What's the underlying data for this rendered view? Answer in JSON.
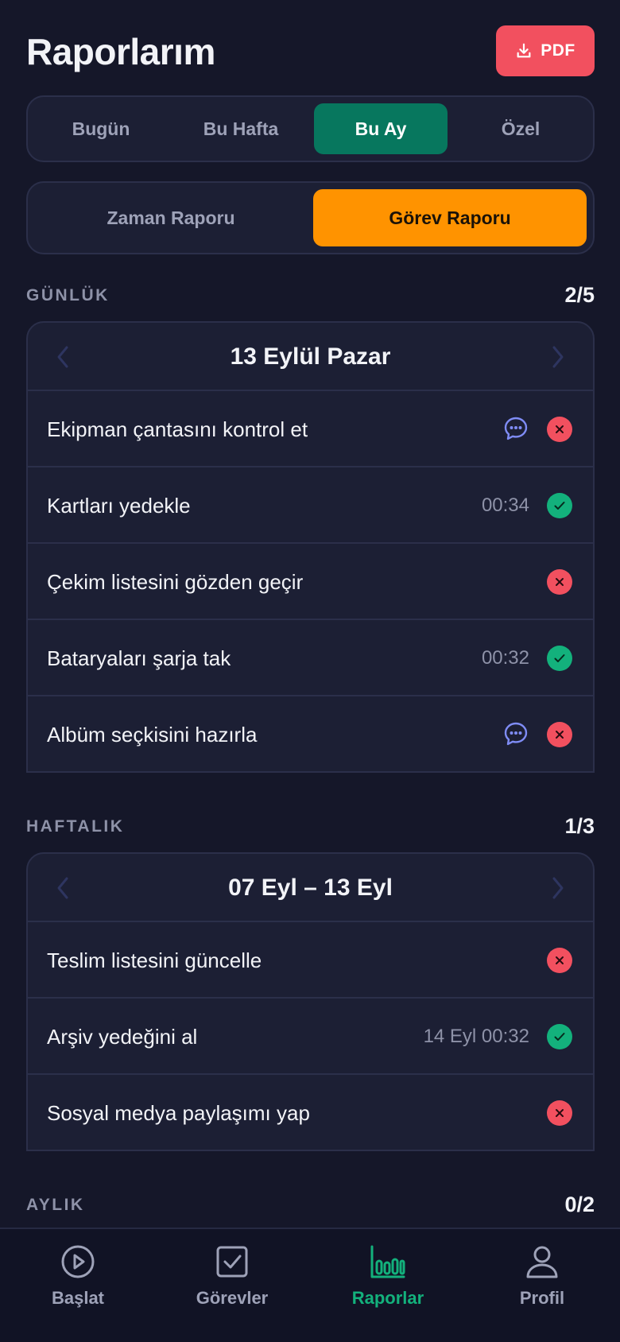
{
  "header": {
    "title": "Raporlarım",
    "pdf_label": "PDF"
  },
  "period_tabs": [
    "Bugün",
    "Bu Hafta",
    "Bu Ay",
    "Özel"
  ],
  "period_selected": "Bu Ay",
  "report_tabs": [
    "Zaman Raporu",
    "Görev Raporu"
  ],
  "report_selected": "Görev Raporu",
  "sections": [
    {
      "label": "GÜNLÜK",
      "count": "2/5",
      "date": "13 Eylül Pazar",
      "tasks": [
        {
          "name": "Ekipman çantasını kontrol et",
          "time": "",
          "has_note": true,
          "status": "fail"
        },
        {
          "name": "Kartları yedekle",
          "time": "00:34",
          "has_note": false,
          "status": "done"
        },
        {
          "name": "Çekim listesini gözden geçir",
          "time": "",
          "has_note": false,
          "status": "fail"
        },
        {
          "name": "Bataryaları şarja tak",
          "time": "00:32",
          "has_note": false,
          "status": "done"
        },
        {
          "name": "Albüm seçkisini hazırla",
          "time": "",
          "has_note": true,
          "status": "fail"
        }
      ]
    },
    {
      "label": "HAFTALIK",
      "count": "1/3",
      "date": "07 Eyl – 13 Eyl",
      "tasks": [
        {
          "name": "Teslim listesini güncelle",
          "time": "",
          "has_note": false,
          "status": "fail"
        },
        {
          "name": "Arşiv yedeğini al",
          "time": "14 Eyl 00:32",
          "has_note": false,
          "status": "done"
        },
        {
          "name": "Sosyal medya paylaşımı yap",
          "time": "",
          "has_note": false,
          "status": "fail"
        }
      ]
    },
    {
      "label": "AYLIK",
      "count": "0/2"
    }
  ],
  "bottom_nav": [
    {
      "label": "Başlat",
      "icon": "play-icon"
    },
    {
      "label": "Görevler",
      "icon": "checkbox-icon"
    },
    {
      "label": "Raporlar",
      "icon": "bar-chart-icon"
    },
    {
      "label": "Profil",
      "icon": "user-icon"
    }
  ],
  "bottom_nav_selected": "Raporlar",
  "colors": {
    "background": "#151729",
    "pdf_button": "#f2505f",
    "period_active": "#07775e",
    "report_active": "#ff9300",
    "status_done": "#13b17c",
    "status_fail": "#f2505f",
    "note_icon": "#7f8cf5",
    "nav_active": "#13b17c"
  }
}
